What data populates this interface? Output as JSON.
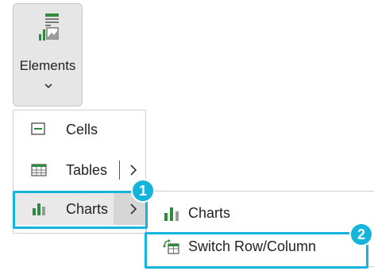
{
  "ribbon": {
    "button_label": "Elements"
  },
  "menu": {
    "items": [
      {
        "label": "Cells",
        "icon": "cells-icon",
        "has_submenu": false
      },
      {
        "label": "Tables",
        "icon": "table-icon",
        "has_submenu": true
      },
      {
        "label": "Charts",
        "icon": "bar-chart-icon",
        "has_submenu": true,
        "active": true
      }
    ]
  },
  "submenu": {
    "items": [
      {
        "label": "Charts",
        "icon": "bar-chart-icon"
      },
      {
        "label": "Switch Row/Column",
        "icon": "switch-row-column-icon"
      }
    ]
  },
  "callouts": [
    {
      "number": "1"
    },
    {
      "number": "2"
    }
  ],
  "colors": {
    "accent": "#14b4dc",
    "chart_green": "#2e8b3e",
    "chart_gray": "#9a9a9a"
  }
}
